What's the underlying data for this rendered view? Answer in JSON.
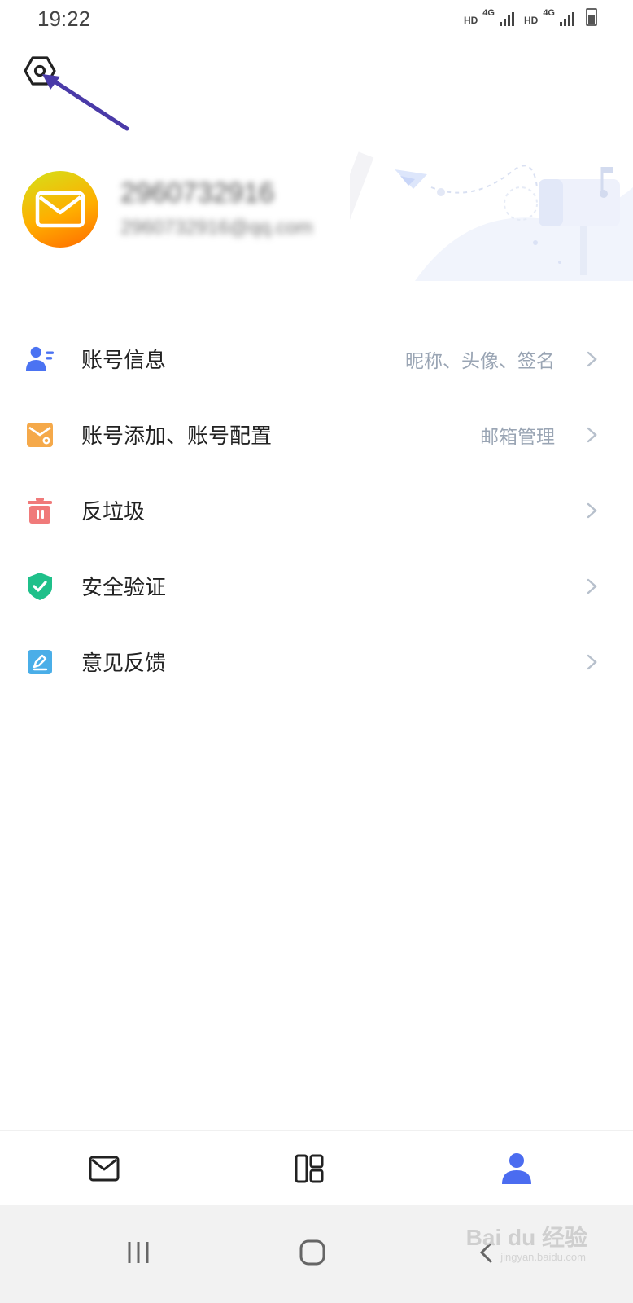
{
  "status_bar": {
    "time": "19:22",
    "network_1": "HD",
    "network_1_gen": "4G",
    "network_2": "HD",
    "network_2_gen": "4G"
  },
  "header": {
    "settings_icon": "settings-gear-icon",
    "annotation_arrow_color": "#4a3aa8"
  },
  "profile": {
    "account_id": "2960732916",
    "email": "2960732916@qq.com",
    "avatar_icon": "mail-icon"
  },
  "menu": {
    "items": [
      {
        "label": "账号信息",
        "hint": "昵称、头像、签名",
        "icon": "user-info-icon",
        "color": "#4b73f2"
      },
      {
        "label": "账号添加、账号配置",
        "hint": "邮箱管理",
        "icon": "mailbox-icon",
        "color": "#f5a94a"
      },
      {
        "label": "反垃圾",
        "hint": "",
        "icon": "trash-icon",
        "color": "#f07a7a"
      },
      {
        "label": "安全验证",
        "hint": "",
        "icon": "shield-check-icon",
        "color": "#1fc08a"
      },
      {
        "label": "意见反馈",
        "hint": "",
        "icon": "feedback-icon",
        "color": "#4aaee8"
      }
    ]
  },
  "tab_bar": {
    "tabs": [
      {
        "icon": "mail-tab-icon",
        "active": false
      },
      {
        "icon": "apps-tab-icon",
        "active": false
      },
      {
        "icon": "profile-tab-icon",
        "active": true
      }
    ],
    "active_color": "#4b6cf0"
  },
  "system_nav": {
    "watermark": "Bai du 经验",
    "watermark_sub": "jingyan.baidu.com"
  }
}
